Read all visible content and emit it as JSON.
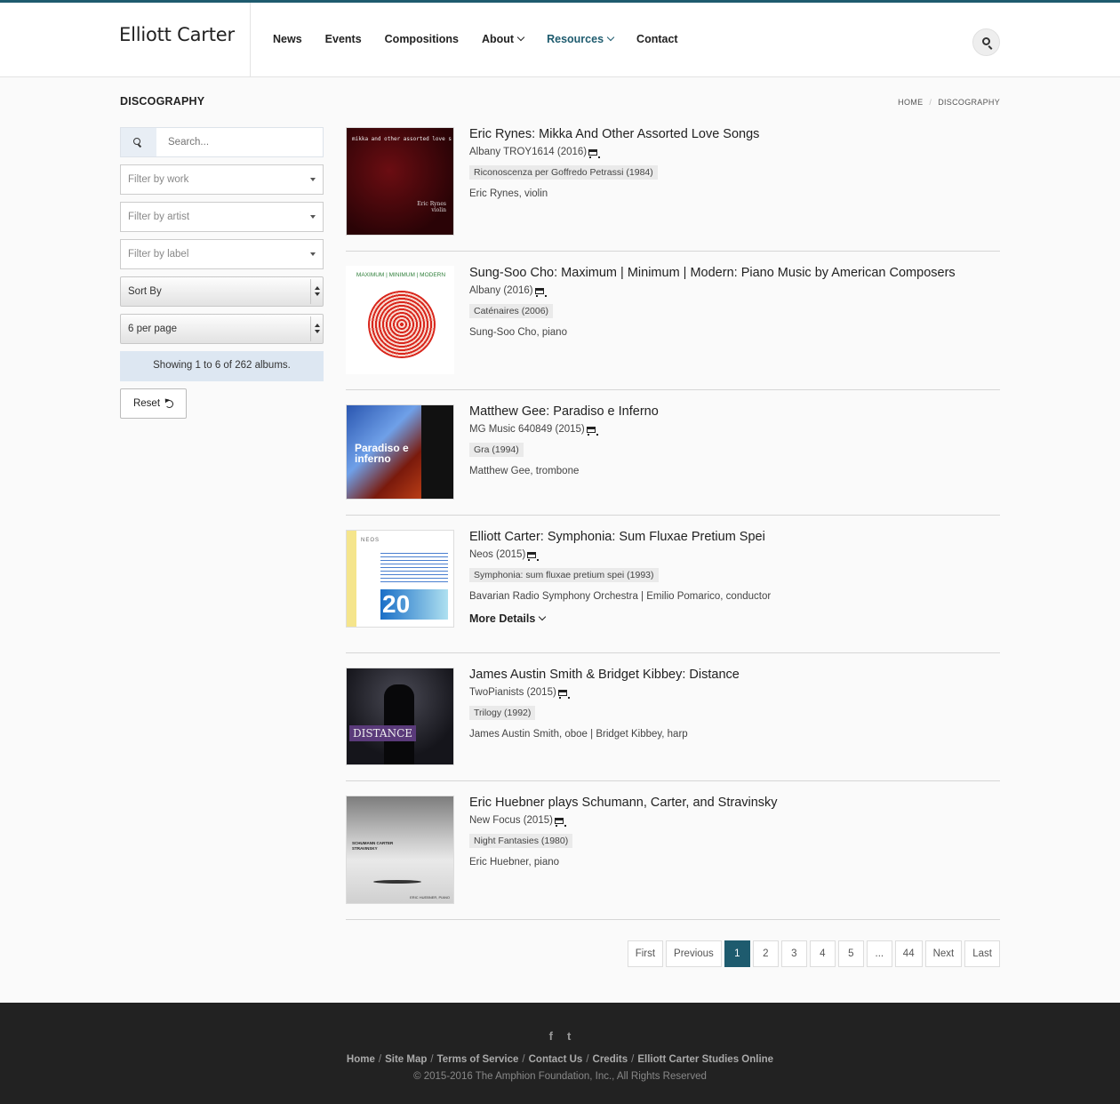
{
  "header": {
    "brand": "Elliott Carter",
    "nav": [
      {
        "label": "News",
        "dropdown": false,
        "active": false
      },
      {
        "label": "Events",
        "dropdown": false,
        "active": false
      },
      {
        "label": "Compositions",
        "dropdown": false,
        "active": false
      },
      {
        "label": "About",
        "dropdown": true,
        "active": false
      },
      {
        "label": "Resources",
        "dropdown": true,
        "active": true
      },
      {
        "label": "Contact",
        "dropdown": false,
        "active": false
      }
    ],
    "accent_color": "#1e5b6e"
  },
  "page": {
    "title": "DISCOGRAPHY",
    "breadcrumb": [
      "HOME",
      "DISCOGRAPHY"
    ]
  },
  "sidebar": {
    "search_placeholder": "Search...",
    "filter_work": "Filter by work",
    "filter_artist": "Filter by artist",
    "filter_label": "Filter by label",
    "sort_by": "Sort By",
    "per_page": "6 per page",
    "showing": "Showing 1 to 6 of 262 albums.",
    "reset": "Reset"
  },
  "albums": [
    {
      "title": "Eric Rynes: Mikka And Other Assorted Love Songs",
      "label": "Albany TROY1614 (2016)",
      "work": "Riconoscenza per Goffredo Petrassi (1984)",
      "performers": "Eric Rynes, violin",
      "more": "",
      "cover_text": "mikka and other assorted love songs",
      "cover_sub": "Eric Rynes violin"
    },
    {
      "title": "Sung-Soo Cho: Maximum | Minimum | Modern: Piano Music by American Composers",
      "label": "Albany (2016)",
      "work": "Caténaires (2006)",
      "performers": "Sung-Soo Cho, piano",
      "more": "",
      "cover_text": "MAXIMUM | MINIMUM | MODERN",
      "cover_sub": ""
    },
    {
      "title": "Matthew Gee: Paradiso e Inferno",
      "label": "MG Music 640849 (2015)",
      "work": "Gra (1994)",
      "performers": "Matthew Gee, trombone",
      "more": "",
      "cover_text": "Paradiso e inferno",
      "cover_sub": ""
    },
    {
      "title": "Elliott Carter: Symphonia: Sum Fluxae Pretium Spei",
      "label": "Neos (2015)",
      "work": "Symphonia: sum fluxae pretium spei (1993)",
      "performers": "Bavarian Radio Symphony Orchestra | Emilio Pomarico, conductor",
      "more": "More Details",
      "cover_text": "NEOS",
      "cover_sub": "20"
    },
    {
      "title": "James Austin Smith & Bridget Kibbey: Distance",
      "label": "TwoPianists (2015)",
      "work": "Trilogy (1992)",
      "performers": "James Austin Smith, oboe | Bridget Kibbey, harp",
      "more": "",
      "cover_text": "DISTANCE",
      "cover_sub": ""
    },
    {
      "title": "Eric Huebner plays Schumann, Carter, and Stravinsky",
      "label": "New Focus (2015)",
      "work": "Night Fantasies (1980)",
      "performers": "Eric Huebner, piano",
      "more": "",
      "cover_text": "SCHUMANN CARTER STRAVINSKY",
      "cover_sub": "ERIC HUEBNER, PIANO"
    }
  ],
  "pagination": [
    "First",
    "Previous",
    "1",
    "2",
    "3",
    "4",
    "5",
    "...",
    "44",
    "Next",
    "Last"
  ],
  "pagination_current": "1",
  "footer": {
    "social": [
      "f",
      "t"
    ],
    "links": [
      "Home",
      "Site Map",
      "Terms of Service",
      "Contact Us",
      "Credits",
      "Elliott Carter Studies Online"
    ],
    "copyright": "© 2015-2016 The Amphion Foundation, Inc., All Rights Reserved"
  }
}
